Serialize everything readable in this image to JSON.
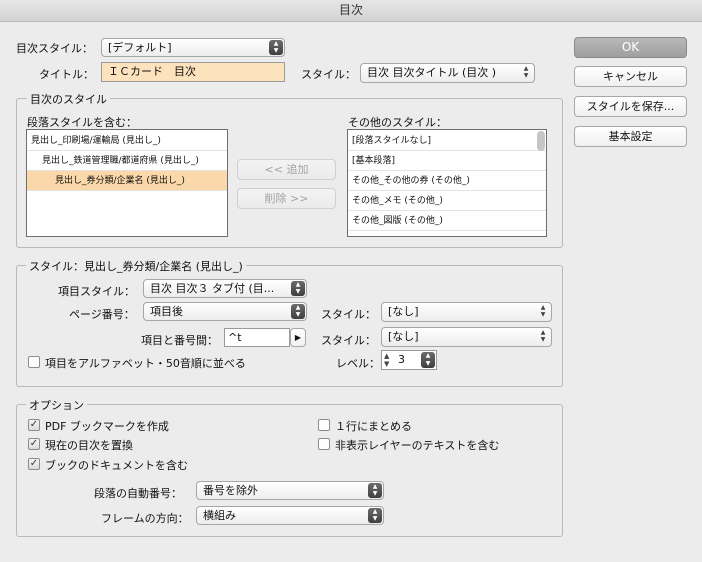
{
  "window": {
    "title": "目次"
  },
  "toc_style": {
    "label": "目次スタイル：",
    "value": "[デフォルト]"
  },
  "title_field": {
    "label": "タイトル：",
    "value": "ＩＣカード　目次"
  },
  "title_style": {
    "label": "スタイル：",
    "value": "目次 目次タイトル (目次 )"
  },
  "buttons": {
    "ok": "OK",
    "cancel": "キャンセル",
    "save_style": "スタイルを保存...",
    "basic": "基本設定"
  },
  "toc_styles_group": {
    "title": "目次のスタイル",
    "include_label": "段落スタイルを含む：",
    "include_items": [
      "見出し_印刷場/運輸局 (見出し_)",
      "見出し_鉄道管理職/都道府県 (見出し_)",
      "見出し_券分類/企業名 (見出し_)"
    ],
    "add_button": "<< 追加",
    "remove_button": "削除 >>",
    "other_label": "その他のスタイル：",
    "other_items": [
      "[段落スタイルなし]",
      "[基本段落]",
      "その他_その他の券 (その他_)",
      "その他_メモ (その他_)",
      "その他_図版 (その他_)"
    ]
  },
  "style_group": {
    "title": "スタイル：見出し_券分類/企業名 (見出し_)",
    "entry_style_label": "項目スタイル：",
    "entry_style_value": "目次 目次３ タブ付 (目...",
    "page_number_label": "ページ番号：",
    "page_number_value": "項目後",
    "page_style_label": "スタイル：",
    "page_style_value": "[なし]",
    "between_label": "項目と番号間：",
    "between_value": "^t",
    "between_style_label": "スタイル：",
    "between_style_value": "[なし]",
    "sort_label": "項目をアルファベット・50音順に並べる",
    "level_label": "レベル：",
    "level_value": "3"
  },
  "options_group": {
    "title": "オプション",
    "pdf_bookmark": "PDF ブックマークを作成",
    "replace_toc": "現在の目次を置換",
    "include_book": "ブックのドキュメントを含む",
    "one_line": "１行にまとめる",
    "hidden_layers": "非表示レイヤーのテキストを含む",
    "auto_number_label": "段落の自動番号：",
    "auto_number_value": "番号を除外",
    "frame_dir_label": "フレームの方向：",
    "frame_dir_value": "横組み"
  }
}
